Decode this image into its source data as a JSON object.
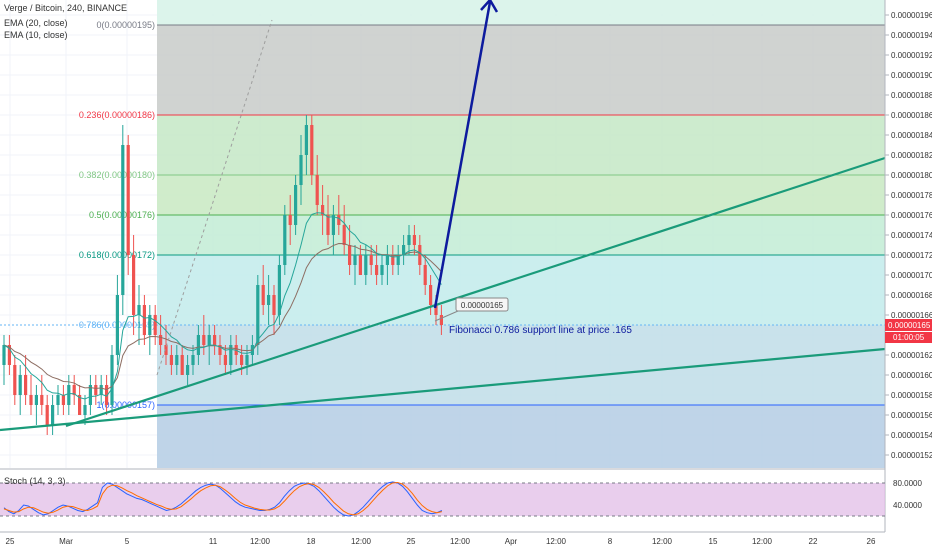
{
  "header": {
    "symbol": "Verge / Bitcoin, 240, BINANCE",
    "ema1": "EMA (20, close)",
    "ema2": "EMA (10, close)"
  },
  "stoch": {
    "label": "Stoch (14, 3, 3)",
    "y_ticks": [
      "80.0000",
      "40.0000"
    ]
  },
  "price_tag": {
    "value": "0.00000165",
    "countdown": "01:00:05"
  },
  "callout": {
    "value": "0.00000165"
  },
  "annotation": "Fibonacci 0.786  support line at price .165",
  "colors": {
    "fib0": "#787b86",
    "fib236": "#f23645",
    "fib382": "#81c784",
    "fib5": "#4caf50",
    "fib618": "#089981",
    "fib786": "#64b5f6",
    "fib1": "#2962ff",
    "trend": "#1a9b7a",
    "arrow": "#0d1b9e",
    "price_tag": "#f23645",
    "stoch_bg": "#e1bee7"
  },
  "chart_data": {
    "type": "candlestick",
    "y_ticks": [
      "0.00000196",
      "0.00000194",
      "0.00000192",
      "0.00000190",
      "0.00000188",
      "0.00000186",
      "0.00000184",
      "0.00000182",
      "0.00000180",
      "0.00000178",
      "0.00000176",
      "0.00000174",
      "0.00000172",
      "0.00000170",
      "0.00000168",
      "0.00000166",
      "0.00000164",
      "0.00000162",
      "0.00000160",
      "0.00000158",
      "0.00000156",
      "0.00000154",
      "0.00000152"
    ],
    "y_tick_values": [
      1.96,
      1.94,
      1.92,
      1.9,
      1.88,
      1.86,
      1.84,
      1.82,
      1.8,
      1.78,
      1.76,
      1.74,
      1.72,
      1.7,
      1.68,
      1.66,
      1.64,
      1.62,
      1.6,
      1.58,
      1.56,
      1.54,
      1.52
    ],
    "ylim": [
      1.51,
      1.97
    ],
    "x_ticks": [
      "25",
      "Mar",
      "5",
      "11",
      "12:00",
      "18",
      "12:00",
      "25",
      "12:00",
      "Apr",
      "12:00",
      "8",
      "12:00",
      "15",
      "12:00",
      "22",
      "26"
    ],
    "fibonacci": [
      {
        "label": "0(0.00000195)",
        "value": 1.95
      },
      {
        "label": "0.236(0.00000186)",
        "value": 1.86
      },
      {
        "label": "0.382(0.00000180)",
        "value": 1.8
      },
      {
        "label": "0.5(0.00000176)",
        "value": 1.76
      },
      {
        "label": "0.618(0.00000172)",
        "value": 1.72
      },
      {
        "label": "0.786(0.00000165)",
        "value": 1.65
      },
      {
        "label": "1(0.00000157)",
        "value": 1.57
      }
    ],
    "candles": [
      [
        1.61,
        1.64,
        1.59,
        1.63
      ],
      [
        1.63,
        1.64,
        1.6,
        1.61
      ],
      [
        1.61,
        1.62,
        1.57,
        1.58
      ],
      [
        1.58,
        1.61,
        1.56,
        1.6
      ],
      [
        1.6,
        1.62,
        1.57,
        1.58
      ],
      [
        1.58,
        1.6,
        1.56,
        1.57
      ],
      [
        1.57,
        1.59,
        1.55,
        1.58
      ],
      [
        1.58,
        1.6,
        1.56,
        1.57
      ],
      [
        1.57,
        1.58,
        1.54,
        1.55
      ],
      [
        1.55,
        1.58,
        1.54,
        1.57
      ],
      [
        1.57,
        1.59,
        1.56,
        1.58
      ],
      [
        1.58,
        1.59,
        1.56,
        1.57
      ],
      [
        1.57,
        1.6,
        1.56,
        1.59
      ],
      [
        1.59,
        1.6,
        1.57,
        1.58
      ],
      [
        1.58,
        1.59,
        1.56,
        1.56
      ],
      [
        1.56,
        1.58,
        1.55,
        1.57
      ],
      [
        1.57,
        1.6,
        1.56,
        1.59
      ],
      [
        1.59,
        1.6,
        1.57,
        1.58
      ],
      [
        1.58,
        1.6,
        1.57,
        1.59
      ],
      [
        1.59,
        1.6,
        1.56,
        1.57
      ],
      [
        1.57,
        1.63,
        1.56,
        1.62
      ],
      [
        1.62,
        1.7,
        1.61,
        1.68
      ],
      [
        1.68,
        1.85,
        1.66,
        1.83
      ],
      [
        1.83,
        1.84,
        1.7,
        1.72
      ],
      [
        1.72,
        1.74,
        1.64,
        1.66
      ],
      [
        1.66,
        1.69,
        1.63,
        1.67
      ],
      [
        1.67,
        1.68,
        1.63,
        1.64
      ],
      [
        1.64,
        1.67,
        1.62,
        1.66
      ],
      [
        1.66,
        1.67,
        1.63,
        1.64
      ],
      [
        1.64,
        1.66,
        1.62,
        1.63
      ],
      [
        1.63,
        1.65,
        1.61,
        1.62
      ],
      [
        1.62,
        1.63,
        1.6,
        1.61
      ],
      [
        1.61,
        1.63,
        1.6,
        1.62
      ],
      [
        1.62,
        1.63,
        1.6,
        1.6
      ],
      [
        1.6,
        1.62,
        1.59,
        1.61
      ],
      [
        1.61,
        1.63,
        1.6,
        1.62
      ],
      [
        1.62,
        1.65,
        1.61,
        1.64
      ],
      [
        1.64,
        1.66,
        1.62,
        1.63
      ],
      [
        1.63,
        1.65,
        1.61,
        1.64
      ],
      [
        1.64,
        1.65,
        1.62,
        1.63
      ],
      [
        1.63,
        1.64,
        1.61,
        1.62
      ],
      [
        1.62,
        1.63,
        1.6,
        1.61
      ],
      [
        1.61,
        1.64,
        1.6,
        1.63
      ],
      [
        1.63,
        1.64,
        1.61,
        1.62
      ],
      [
        1.62,
        1.63,
        1.6,
        1.61
      ],
      [
        1.61,
        1.63,
        1.6,
        1.62
      ],
      [
        1.62,
        1.64,
        1.61,
        1.63
      ],
      [
        1.63,
        1.7,
        1.62,
        1.69
      ],
      [
        1.69,
        1.71,
        1.66,
        1.67
      ],
      [
        1.67,
        1.7,
        1.65,
        1.68
      ],
      [
        1.68,
        1.69,
        1.64,
        1.66
      ],
      [
        1.66,
        1.72,
        1.65,
        1.71
      ],
      [
        1.71,
        1.77,
        1.7,
        1.76
      ],
      [
        1.76,
        1.78,
        1.73,
        1.75
      ],
      [
        1.75,
        1.8,
        1.74,
        1.79
      ],
      [
        1.79,
        1.84,
        1.77,
        1.82
      ],
      [
        1.82,
        1.86,
        1.8,
        1.85
      ],
      [
        1.85,
        1.86,
        1.79,
        1.8
      ],
      [
        1.8,
        1.82,
        1.76,
        1.77
      ],
      [
        1.77,
        1.79,
        1.74,
        1.76
      ],
      [
        1.76,
        1.78,
        1.73,
        1.74
      ],
      [
        1.74,
        1.77,
        1.72,
        1.76
      ],
      [
        1.76,
        1.78,
        1.74,
        1.75
      ],
      [
        1.75,
        1.77,
        1.72,
        1.73
      ],
      [
        1.73,
        1.75,
        1.7,
        1.71
      ],
      [
        1.71,
        1.73,
        1.69,
        1.72
      ],
      [
        1.72,
        1.73,
        1.7,
        1.7
      ],
      [
        1.7,
        1.73,
        1.69,
        1.72
      ],
      [
        1.72,
        1.73,
        1.7,
        1.71
      ],
      [
        1.71,
        1.73,
        1.69,
        1.7
      ],
      [
        1.7,
        1.72,
        1.69,
        1.71
      ],
      [
        1.71,
        1.73,
        1.69,
        1.72
      ],
      [
        1.72,
        1.73,
        1.7,
        1.71
      ],
      [
        1.71,
        1.73,
        1.7,
        1.72
      ],
      [
        1.72,
        1.74,
        1.71,
        1.73
      ],
      [
        1.73,
        1.75,
        1.72,
        1.74
      ],
      [
        1.74,
        1.75,
        1.72,
        1.73
      ],
      [
        1.73,
        1.74,
        1.7,
        1.71
      ],
      [
        1.71,
        1.72,
        1.68,
        1.69
      ],
      [
        1.69,
        1.7,
        1.66,
        1.67
      ],
      [
        1.67,
        1.68,
        1.65,
        1.66
      ],
      [
        1.66,
        1.67,
        1.64,
        1.65
      ]
    ],
    "stoch_k": [
      35,
      28,
      24,
      30,
      40,
      38,
      32,
      26,
      22,
      24,
      30,
      36,
      40,
      38,
      34,
      30,
      28,
      32,
      38,
      44,
      72,
      80,
      78,
      72,
      66,
      60,
      56,
      52,
      50,
      46,
      42,
      38,
      34,
      30,
      32,
      36,
      42,
      50,
      58,
      66,
      72,
      76,
      78,
      76,
      70,
      62,
      54,
      46,
      40,
      36,
      34,
      32,
      30,
      30,
      32,
      36,
      44,
      56,
      66,
      74,
      78,
      80,
      78,
      74,
      66,
      56,
      46,
      36,
      28,
      22,
      20,
      22,
      28,
      36,
      46,
      56,
      66,
      74,
      80,
      82,
      80,
      74,
      64,
      52,
      40,
      30,
      26,
      24,
      26,
      30
    ],
    "stoch_d": [
      33,
      30,
      27,
      28,
      33,
      36,
      35,
      31,
      27,
      25,
      27,
      31,
      36,
      38,
      37,
      34,
      31,
      30,
      33,
      38,
      60,
      72,
      76,
      75,
      71,
      66,
      62,
      57,
      53,
      49,
      45,
      41,
      38,
      34,
      32,
      33,
      37,
      44,
      51,
      59,
      66,
      71,
      75,
      76,
      73,
      67,
      60,
      52,
      45,
      40,
      37,
      34,
      32,
      31,
      31,
      33,
      38,
      47,
      57,
      66,
      73,
      77,
      79,
      77,
      72,
      64,
      55,
      45,
      37,
      29,
      24,
      22,
      24,
      30,
      38,
      48,
      58,
      67,
      75,
      80,
      81,
      78,
      71,
      61,
      49,
      39,
      32,
      28,
      26,
      28
    ]
  }
}
